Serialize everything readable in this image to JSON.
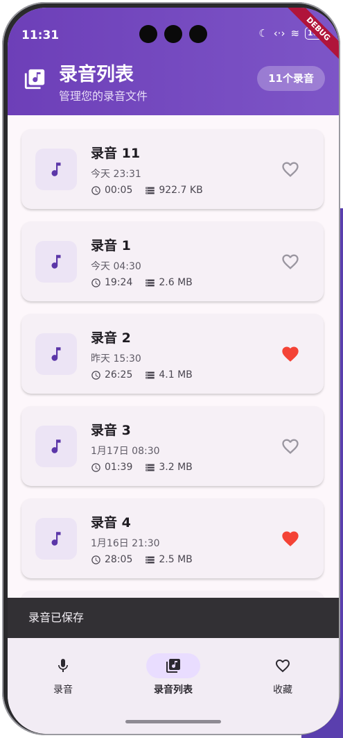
{
  "status_bar": {
    "time": "11:31",
    "battery": "100"
  },
  "debug_banner": "DEBUG",
  "header": {
    "title": "录音列表",
    "subtitle": "管理您的录音文件",
    "count_badge": "11个录音"
  },
  "recordings": [
    {
      "name": "录音 11",
      "date": "今天 23:31",
      "duration": "00:05",
      "size": "922.7 KB",
      "favorite": false
    },
    {
      "name": "录音 1",
      "date": "今天 04:30",
      "duration": "19:24",
      "size": "2.6 MB",
      "favorite": false
    },
    {
      "name": "录音 2",
      "date": "昨天 15:30",
      "duration": "26:25",
      "size": "4.1 MB",
      "favorite": true
    },
    {
      "name": "录音 3",
      "date": "1月17日 08:30",
      "duration": "01:39",
      "size": "3.2 MB",
      "favorite": false
    },
    {
      "name": "录音 4",
      "date": "1月16日 21:30",
      "duration": "28:05",
      "size": "2.5 MB",
      "favorite": true
    }
  ],
  "snackbar": {
    "message": "录音已保存"
  },
  "bottom_nav": [
    {
      "label": "录音",
      "icon": "mic-icon",
      "active": false
    },
    {
      "label": "录音列表",
      "icon": "library-music-icon",
      "active": true
    },
    {
      "label": "收藏",
      "icon": "heart-outline-icon",
      "active": false
    }
  ],
  "colors": {
    "primary": "#6d3fb8",
    "favorite": "#f44336",
    "icon_tint": "#5b36a8"
  }
}
